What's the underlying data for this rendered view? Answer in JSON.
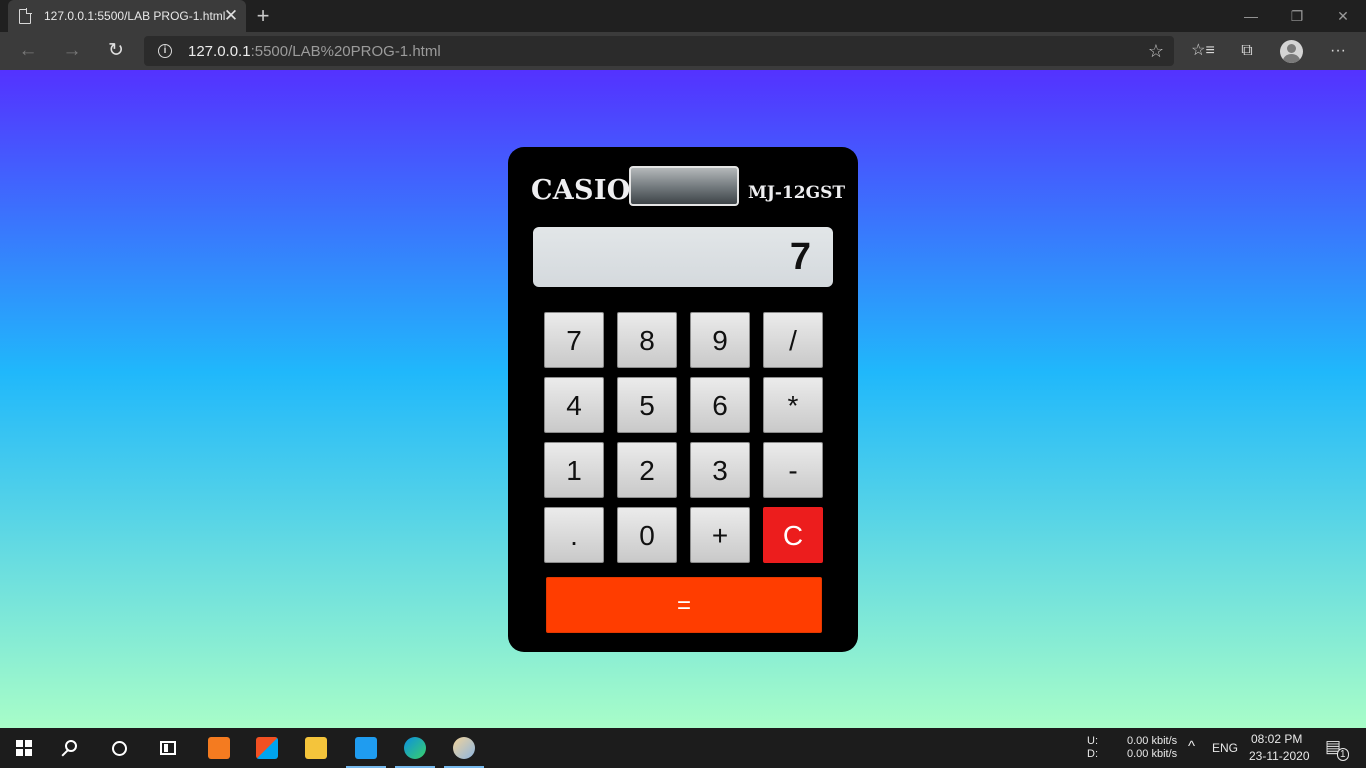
{
  "browser": {
    "tab_title": "127.0.0.1:5500/LAB PROG-1.html",
    "tab_close": "✕",
    "new_tab": "+",
    "url_host": "127.0.0.1",
    "url_rest": ":5500/LAB%20PROG-1.html",
    "window": {
      "minimize": "—",
      "restore": "❐",
      "close": "✕"
    },
    "nav": {
      "back": "←",
      "forward": "→",
      "refresh": "↻"
    },
    "toolbar_icons": {
      "favorite": "☆",
      "favorites_list": "☆≡",
      "collections": "⧉",
      "menu": "···"
    }
  },
  "calculator": {
    "brand": "CASIO",
    "model": "MJ-12GST",
    "display_value": "7",
    "keys": [
      [
        "7",
        "8",
        "9",
        "/"
      ],
      [
        "4",
        "5",
        "6",
        "*"
      ],
      [
        "1",
        "2",
        "3",
        "-"
      ],
      [
        ".",
        "0",
        "+",
        "C"
      ]
    ],
    "equals": "=",
    "colors": {
      "clear_key": "#ec1d1d",
      "equals_key": "#ff3d00",
      "gradient_top": "#5432ff",
      "gradient_mid": "#20b8fb",
      "gradient_bottom": "#a8fdc8"
    }
  },
  "taskbar": {
    "apps": [
      "start-icon",
      "search-icon",
      "cortana-icon",
      "task-view-icon",
      "xampp-icon",
      "store-icon",
      "file-explorer-icon",
      "vscode-icon",
      "edge-icon",
      "paint-icon"
    ],
    "net_up_label": "U:",
    "net_down_label": "D:",
    "net_up_value": "0.00 kbit/s",
    "net_down_value": "0.00 kbit/s",
    "tray_chevron": "^",
    "language": "ENG",
    "time": "08:02  PM",
    "date": "23-11-2020",
    "notification_count": "1"
  }
}
